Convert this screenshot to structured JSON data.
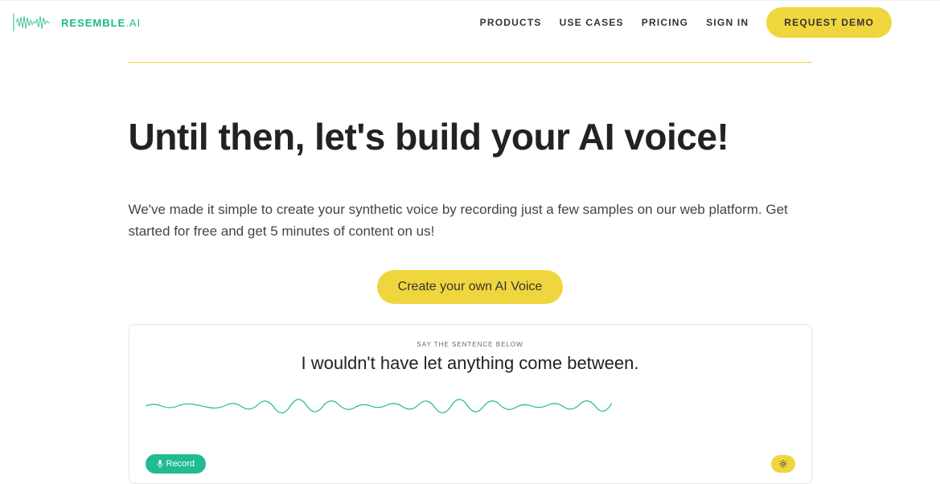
{
  "logo": {
    "text": "RESEMBLE",
    "suffix": ".AI"
  },
  "nav": {
    "products": "PRODUCTS",
    "use_cases": "USE CASES",
    "pricing": "PRICING",
    "sign_in": "SIGN IN",
    "demo": "REQUEST DEMO"
  },
  "main": {
    "heading": "Until then, let's build your AI voice!",
    "subtext": "We've made it simple to create your synthetic voice by recording just a few samples on our web platform. Get started for free and get 5 minutes of content on us!",
    "cta": "Create your own AI Voice"
  },
  "recorder": {
    "say_label": "SAY THE SENTENCE BELOW",
    "sentence": "I wouldn't have let anything come between.",
    "record_label": "Record"
  },
  "colors": {
    "accent_yellow": "#f0d63e",
    "accent_green": "#20bb91",
    "brand_teal": "#1db88a"
  }
}
